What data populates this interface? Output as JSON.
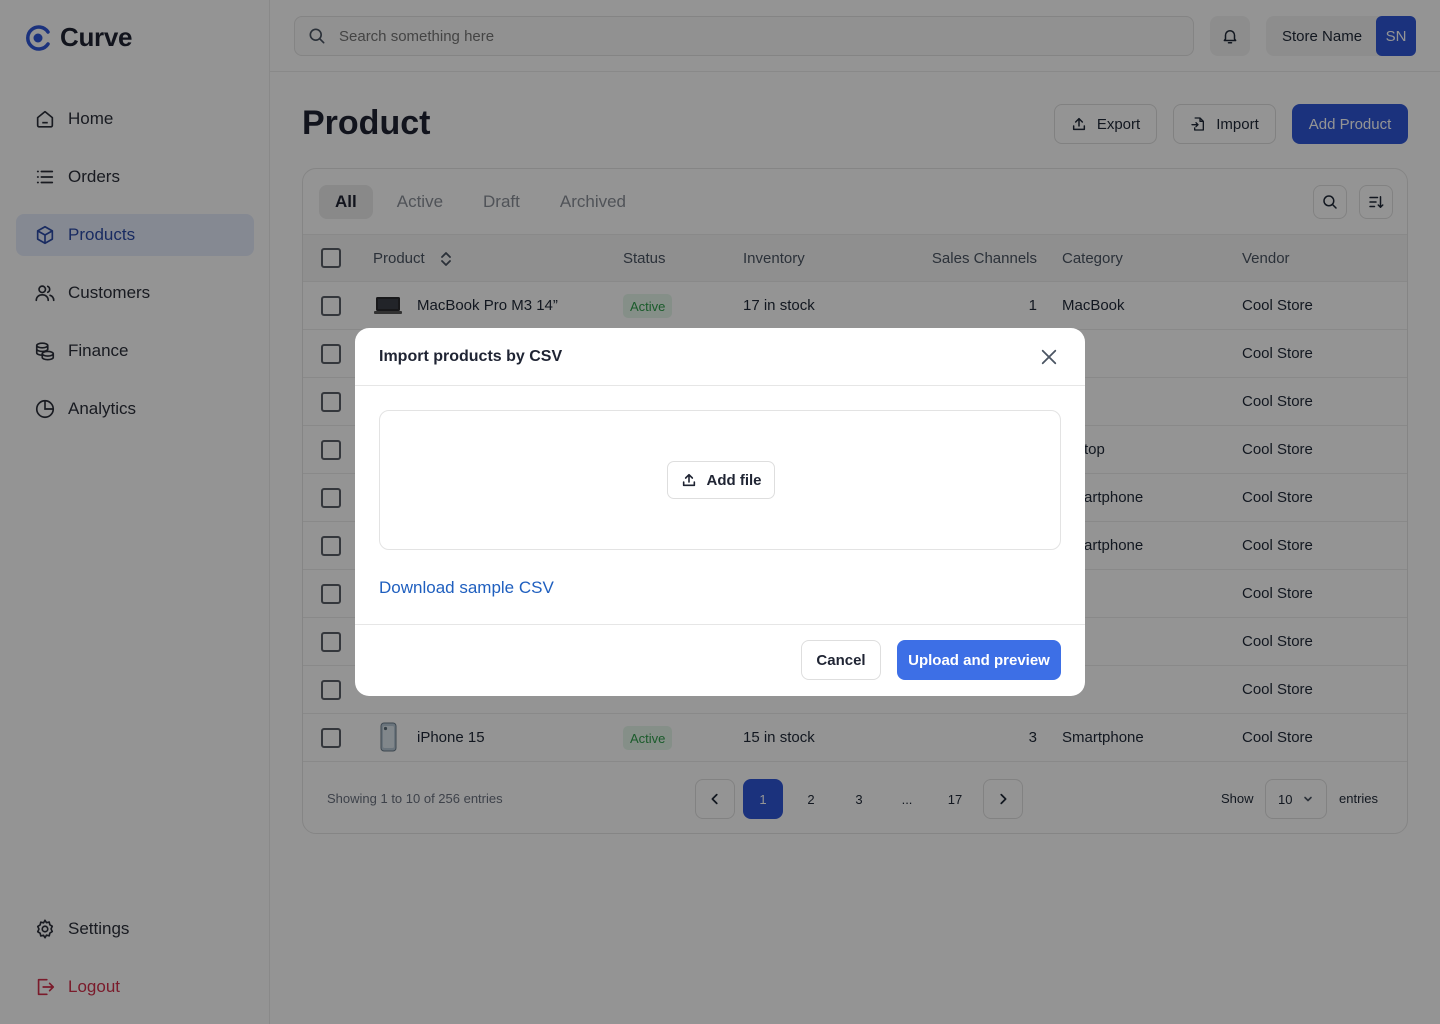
{
  "brand": {
    "name": "Curve",
    "color": "#2f57d8"
  },
  "nav": {
    "items": [
      {
        "label": "Home",
        "icon": "home-icon"
      },
      {
        "label": "Orders",
        "icon": "list-icon"
      },
      {
        "label": "Products",
        "icon": "box-icon",
        "active": true
      },
      {
        "label": "Customers",
        "icon": "users-icon"
      },
      {
        "label": "Finance",
        "icon": "coins-icon"
      },
      {
        "label": "Analytics",
        "icon": "pie-chart-icon"
      }
    ],
    "settings_label": "Settings",
    "logout_label": "Logout"
  },
  "topbar": {
    "search_placeholder": "Search something here",
    "store_name": "Store Name",
    "avatar_initials": "SN"
  },
  "page": {
    "title": "Product",
    "export_label": "Export",
    "import_label": "Import",
    "add_label": "Add Product"
  },
  "tabs": [
    "All",
    "Active",
    "Draft",
    "Archived"
  ],
  "table": {
    "headers": {
      "product": "Product",
      "status": "Status",
      "inventory": "Inventory",
      "channels": "Sales Channels",
      "category": "Category",
      "vendor": "Vendor"
    },
    "rows": [
      {
        "product": "MacBook Pro M3 14”",
        "status": "Active",
        "inventory": "17 in stock",
        "channels": "1",
        "category": "MacBook",
        "vendor": "Cool Store"
      },
      {
        "product": "",
        "status": "",
        "inventory": "",
        "channels": "",
        "category": "",
        "vendor": "Cool Store"
      },
      {
        "product": "",
        "status": "",
        "inventory": "",
        "channels": "",
        "category": "",
        "vendor": "Cool Store"
      },
      {
        "product": "",
        "status": "",
        "inventory": "",
        "channels": "",
        "category": "top",
        "vendor": "Cool Store"
      },
      {
        "product": "",
        "status": "",
        "inventory": "",
        "channels": "",
        "category": "artphone",
        "vendor": "Cool Store"
      },
      {
        "product": "",
        "status": "",
        "inventory": "",
        "channels": "",
        "category": "artphone",
        "vendor": "Cool Store"
      },
      {
        "product": "",
        "status": "",
        "inventory": "",
        "channels": "",
        "category": "",
        "vendor": "Cool Store"
      },
      {
        "product": "",
        "status": "",
        "inventory": "",
        "channels": "",
        "category": "",
        "vendor": "Cool Store"
      },
      {
        "product": "",
        "status": "",
        "inventory": "",
        "channels": "",
        "category": "",
        "vendor": "Cool Store"
      },
      {
        "product": "iPhone 15",
        "status": "Active",
        "inventory": "15 in stock",
        "channels": "3",
        "category": "Smartphone",
        "vendor": "Cool Store"
      }
    ]
  },
  "pagination": {
    "summary": "Showing 1 to 10 of 256 entries",
    "pages": [
      "1",
      "2",
      "3",
      "...",
      "17"
    ],
    "current": "1",
    "show_label": "Show",
    "show_value": "10",
    "entries_label": "entries"
  },
  "modal": {
    "title": "Import products by CSV",
    "add_file_label": "Add file",
    "download_link": "Download sample CSV",
    "cancel_label": "Cancel",
    "upload_label": "Upload and preview"
  },
  "colors": {
    "primary": "#2f57d8",
    "upload_button": "#3d6fe6",
    "link": "#1f5fbf",
    "active_badge_bg": "#e6f7ea",
    "active_badge_text": "#2e9d4b",
    "logout": "#d32f4a"
  }
}
